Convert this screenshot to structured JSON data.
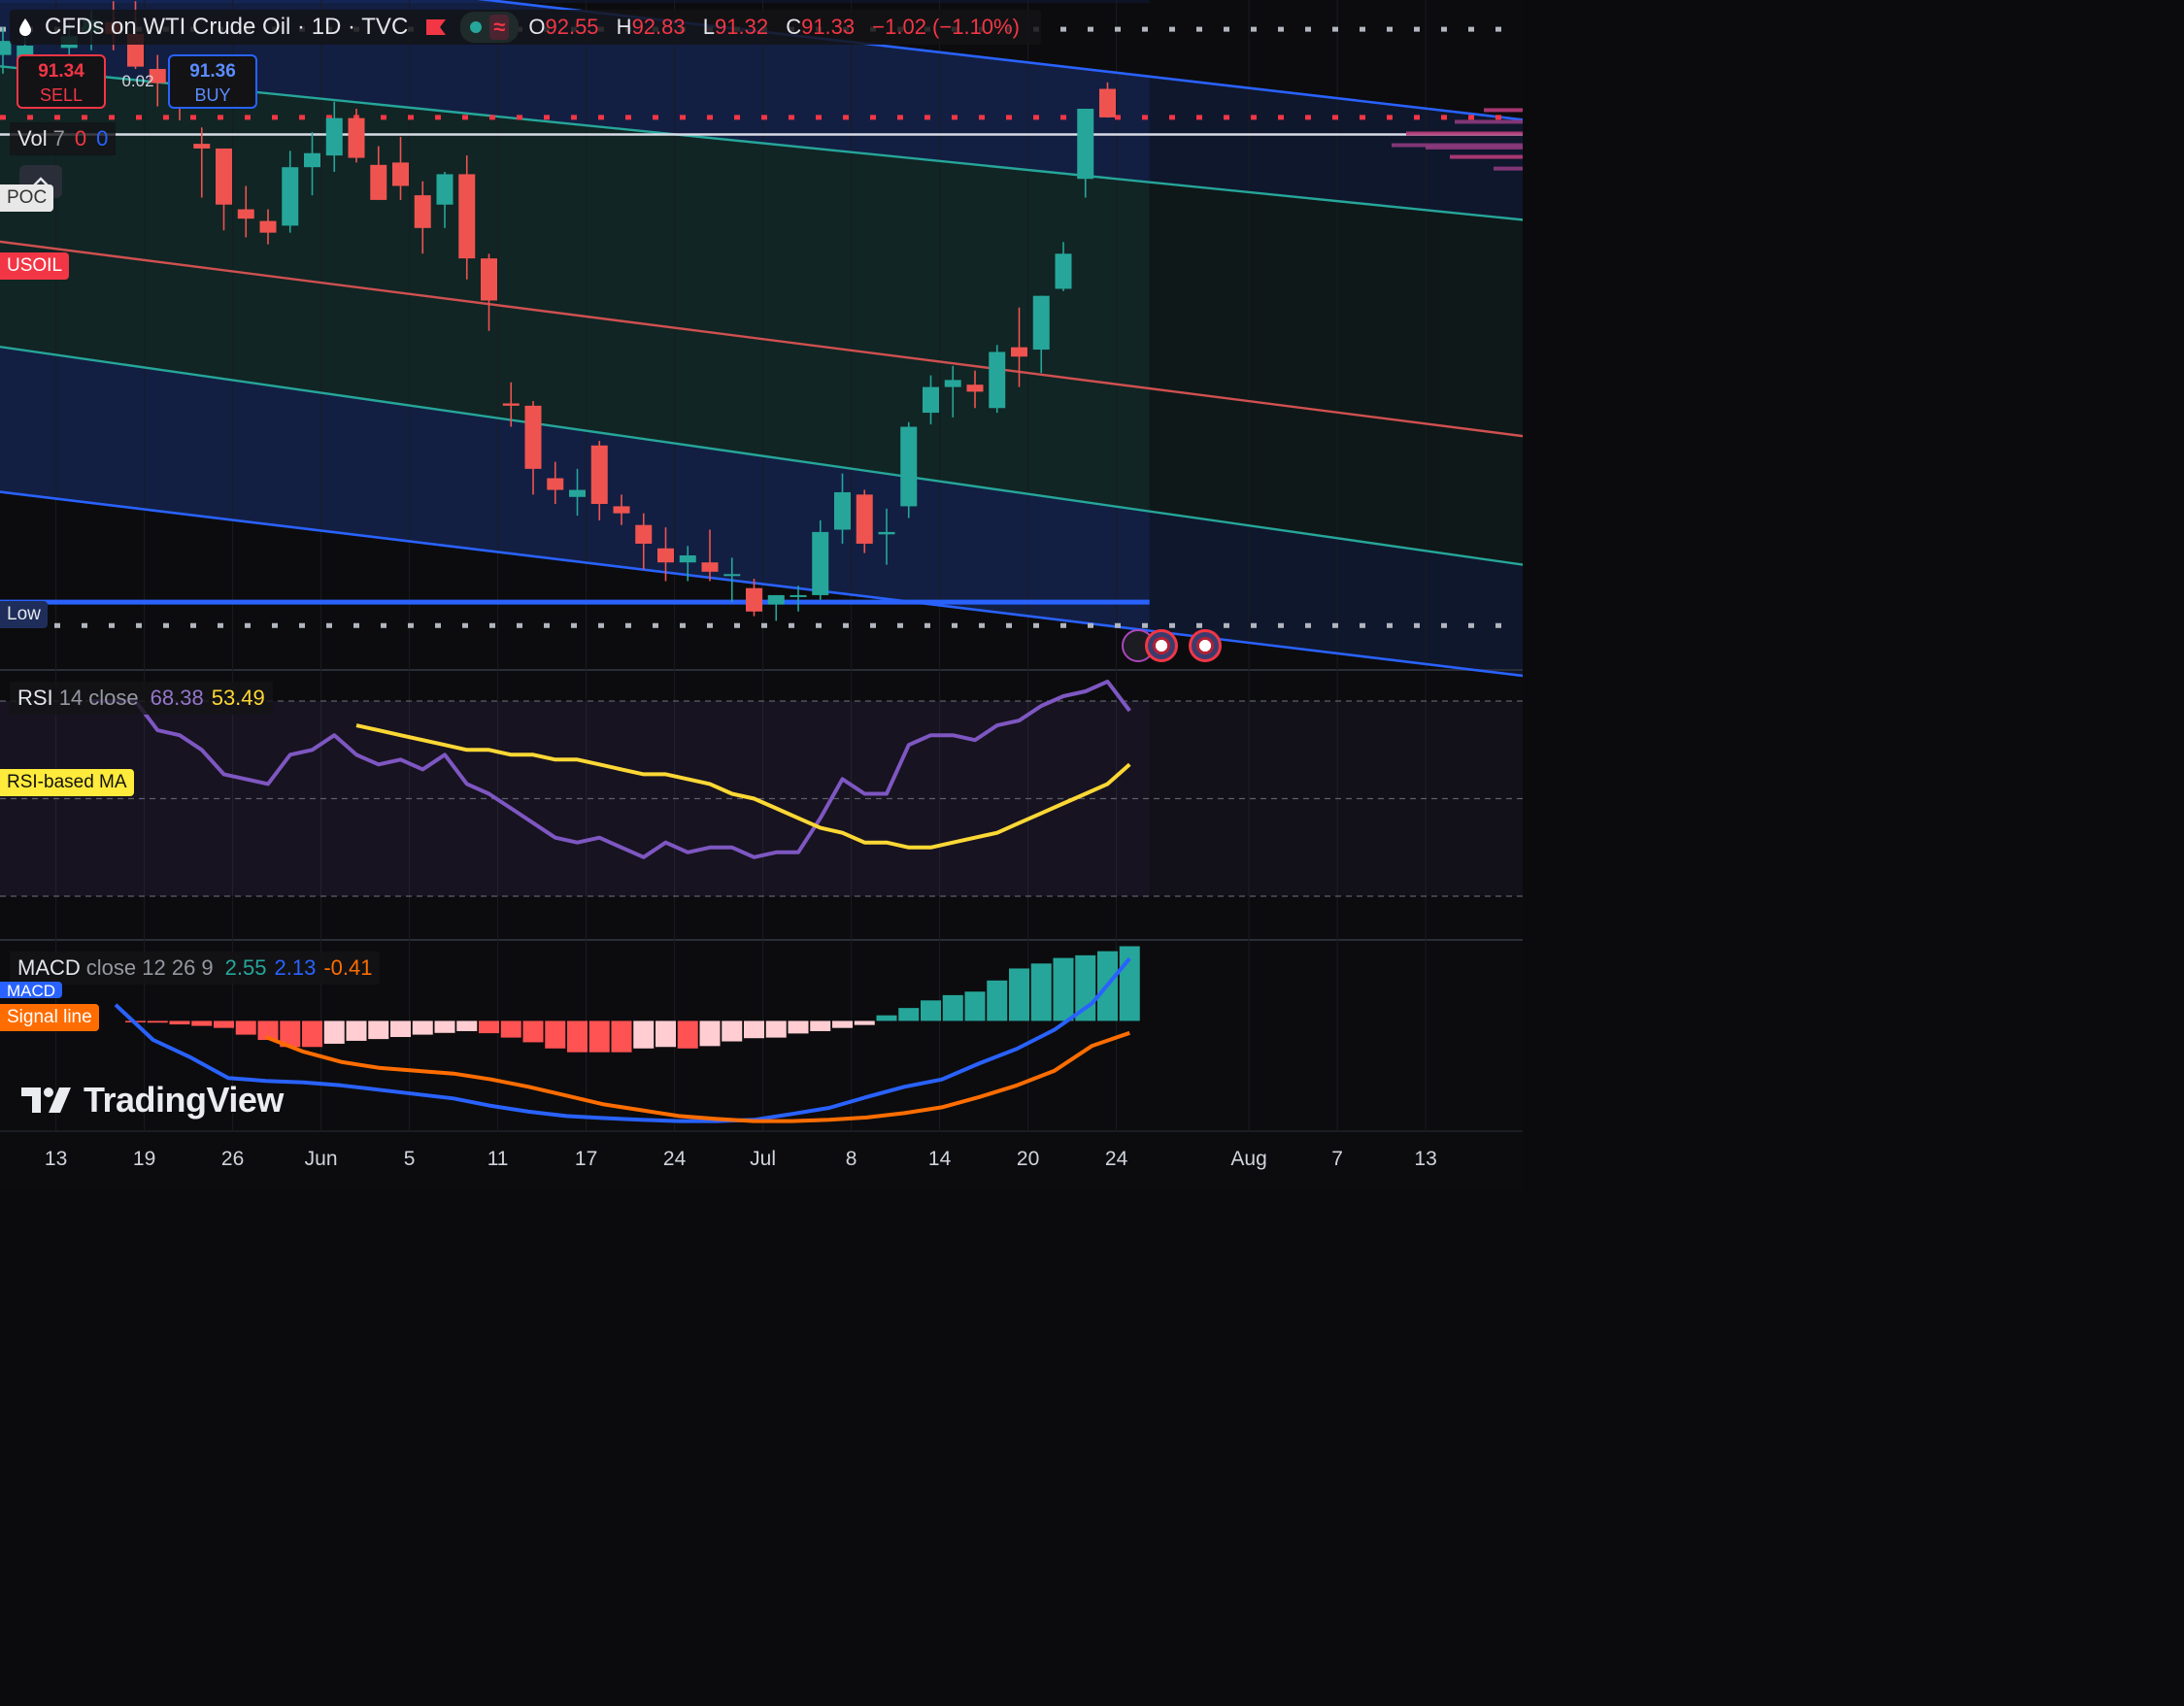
{
  "header": {
    "symbol_title": "CFDs on WTI Crude Oil · 1D · TVC",
    "ohlc": [
      {
        "k": "O",
        "v": "92.55"
      },
      {
        "k": "H",
        "v": "92.83"
      },
      {
        "k": "L",
        "v": "91.32"
      },
      {
        "k": "C",
        "v": "91.33"
      }
    ],
    "change": "−1.02 (−1.10%)"
  },
  "trade": {
    "sell_price": "91.34",
    "sell_label": "SELL",
    "spread": "0.02",
    "buy_price": "91.36",
    "buy_label": "BUY"
  },
  "volume": {
    "label": "Vol",
    "length": "7",
    "v1": "0",
    "v2": "0"
  },
  "price_tags": {
    "poc": "POC",
    "usoil": "USOIL",
    "low": "Low"
  },
  "rsi": {
    "label": "RSI",
    "params": "14 close",
    "value": "68.38",
    "ma_value": "53.49",
    "ma_tag": "RSI-based MA"
  },
  "macd": {
    "label": "MACD",
    "params": "close 12 26 9",
    "hist": "2.55",
    "macd": "2.13",
    "signal": "-0.41",
    "macd_tag": "MACD",
    "signal_tag": "Signal line"
  },
  "logo": {
    "text": "TradingView"
  },
  "colors": {
    "up": "#26a69a",
    "down": "#ef5350",
    "rsi": "#7e57c2",
    "rsi_ma": "#fdd835",
    "macd": "#2962ff",
    "signal": "#ff6d00",
    "channel": "#2962ff",
    "channel_mid": "#d05050",
    "channel_inner": "#26a69a"
  },
  "chart_data": [
    {
      "type": "candlestick",
      "title": "CFDs on WTI Crude Oil · 1D · TVC",
      "x_ticks": [
        "13",
        "19",
        "26",
        "Jun",
        "5",
        "11",
        "17",
        "24",
        "Jul",
        "8",
        "14",
        "20",
        "24",
        "Aug",
        "7",
        "13"
      ],
      "ylim": [
        67.7,
        96.35
      ],
      "candles": [
        {
          "o": 94.0,
          "h": 95.2,
          "l": 93.2,
          "c": 94.6
        },
        {
          "o": 93.8,
          "h": 94.8,
          "l": 93.0,
          "c": 94.4
        },
        {
          "o": 92.9,
          "h": 93.4,
          "l": 92.2,
          "c": 93.5
        },
        {
          "o": 94.3,
          "h": 95.4,
          "l": 93.5,
          "c": 94.8
        },
        {
          "o": 95.0,
          "h": 95.9,
          "l": 94.2,
          "c": 95.5
        },
        {
          "o": 95.4,
          "h": 96.3,
          "l": 94.2,
          "c": 94.9
        },
        {
          "o": 94.9,
          "h": 96.3,
          "l": 93.4,
          "c": 93.5
        },
        {
          "o": 93.4,
          "h": 94.0,
          "l": 91.8,
          "c": 92.8
        },
        {
          "o": 92.8,
          "h": 93.6,
          "l": 91.2,
          "c": 92.2
        },
        {
          "o": 90.2,
          "h": 90.9,
          "l": 87.9,
          "c": 90.0
        },
        {
          "o": 90.0,
          "h": 90.0,
          "l": 86.5,
          "c": 87.6
        },
        {
          "o": 87.4,
          "h": 88.4,
          "l": 86.2,
          "c": 87.0
        },
        {
          "o": 86.9,
          "h": 87.4,
          "l": 85.9,
          "c": 86.4
        },
        {
          "o": 86.7,
          "h": 89.9,
          "l": 86.4,
          "c": 89.2
        },
        {
          "o": 89.2,
          "h": 90.7,
          "l": 88.0,
          "c": 89.8
        },
        {
          "o": 89.7,
          "h": 92.0,
          "l": 89.0,
          "c": 91.3
        },
        {
          "o": 91.3,
          "h": 91.7,
          "l": 89.4,
          "c": 89.6
        },
        {
          "o": 89.3,
          "h": 90.1,
          "l": 87.8,
          "c": 87.8
        },
        {
          "o": 89.4,
          "h": 90.5,
          "l": 87.8,
          "c": 88.4
        },
        {
          "o": 88.0,
          "h": 88.6,
          "l": 85.5,
          "c": 86.6
        },
        {
          "o": 87.6,
          "h": 89.0,
          "l": 86.6,
          "c": 88.9
        },
        {
          "o": 88.9,
          "h": 89.7,
          "l": 84.4,
          "c": 85.3
        },
        {
          "o": 85.3,
          "h": 85.5,
          "l": 82.2,
          "c": 83.5
        },
        {
          "o": 79.1,
          "h": 80.0,
          "l": 78.1,
          "c": 79.0
        },
        {
          "o": 79.0,
          "h": 79.2,
          "l": 75.2,
          "c": 76.3
        },
        {
          "o": 75.9,
          "h": 76.6,
          "l": 74.8,
          "c": 75.4
        },
        {
          "o": 75.1,
          "h": 76.3,
          "l": 74.3,
          "c": 75.4
        },
        {
          "o": 77.3,
          "h": 77.5,
          "l": 74.1,
          "c": 74.8
        },
        {
          "o": 74.7,
          "h": 75.2,
          "l": 73.9,
          "c": 74.4
        },
        {
          "o": 73.9,
          "h": 74.4,
          "l": 72.0,
          "c": 73.1
        },
        {
          "o": 72.9,
          "h": 73.8,
          "l": 71.5,
          "c": 72.3
        },
        {
          "o": 72.3,
          "h": 73.0,
          "l": 71.5,
          "c": 72.6
        },
        {
          "o": 72.3,
          "h": 73.7,
          "l": 71.5,
          "c": 71.9
        },
        {
          "o": 71.8,
          "h": 72.5,
          "l": 70.6,
          "c": 71.8
        },
        {
          "o": 71.2,
          "h": 71.6,
          "l": 70.0,
          "c": 70.2
        },
        {
          "o": 70.5,
          "h": 70.9,
          "l": 69.8,
          "c": 70.9
        },
        {
          "o": 70.9,
          "h": 71.3,
          "l": 70.2,
          "c": 70.9
        },
        {
          "o": 70.9,
          "h": 74.1,
          "l": 70.7,
          "c": 73.6
        },
        {
          "o": 73.7,
          "h": 76.1,
          "l": 73.1,
          "c": 75.3
        },
        {
          "o": 75.2,
          "h": 75.4,
          "l": 72.7,
          "c": 73.1
        },
        {
          "o": 73.5,
          "h": 74.6,
          "l": 72.2,
          "c": 73.6
        },
        {
          "o": 74.7,
          "h": 78.3,
          "l": 74.2,
          "c": 78.1
        },
        {
          "o": 78.7,
          "h": 80.3,
          "l": 78.2,
          "c": 79.8
        },
        {
          "o": 79.8,
          "h": 80.7,
          "l": 78.5,
          "c": 80.1
        },
        {
          "o": 79.9,
          "h": 80.5,
          "l": 78.9,
          "c": 79.6
        },
        {
          "o": 78.9,
          "h": 81.6,
          "l": 78.7,
          "c": 81.3
        },
        {
          "o": 81.5,
          "h": 83.2,
          "l": 79.8,
          "c": 81.1
        },
        {
          "o": 81.4,
          "h": 83.7,
          "l": 80.4,
          "c": 83.7
        },
        {
          "o": 84.0,
          "h": 86.0,
          "l": 83.9,
          "c": 85.5
        },
        {
          "o": 88.7,
          "h": 91.5,
          "l": 87.9,
          "c": 91.7
        },
        {
          "o": 92.55,
          "h": 92.83,
          "l": 91.32,
          "c": 91.33
        }
      ],
      "levels": [
        {
          "name": "POC",
          "value": 90.6
        },
        {
          "name": "USOIL",
          "value": 91.33
        },
        {
          "name": "Low",
          "value": 69.6
        }
      ]
    },
    {
      "type": "line",
      "title": "RSI 14 close",
      "ylim": [
        0,
        100
      ],
      "guides": [
        70,
        50,
        30
      ],
      "series": [
        {
          "name": "RSI",
          "values": [
            70,
            70,
            70,
            64,
            63,
            60,
            55,
            54,
            53,
            59,
            60,
            63,
            59,
            57,
            58,
            56,
            59,
            53,
            51,
            48,
            45,
            42,
            41,
            42,
            40,
            38,
            41,
            39,
            40,
            40,
            38,
            39,
            39,
            46,
            54,
            51,
            51,
            61,
            63,
            63,
            62,
            65,
            66,
            69,
            71,
            72,
            74,
            68
          ]
        },
        {
          "name": "RSI-based MA",
          "values": [
            65,
            64,
            63,
            62,
            61,
            60,
            60,
            59,
            59,
            58,
            58,
            57,
            56,
            55,
            55,
            54,
            53,
            51,
            50,
            48,
            46,
            44,
            43,
            41,
            41,
            40,
            40,
            41,
            42,
            43,
            45,
            47,
            49,
            51,
            53,
            57
          ]
        }
      ]
    },
    {
      "type": "bar",
      "title": "MACD close 12 26 9",
      "ylim": [
        -3.7,
        2.7
      ],
      "series": [
        {
          "name": "Histogram",
          "values": [
            -0.05,
            -0.06,
            -0.12,
            -0.17,
            -0.24,
            -0.47,
            -0.65,
            -0.89,
            -0.89,
            -0.78,
            -0.68,
            -0.62,
            -0.55,
            -0.47,
            -0.41,
            -0.35,
            -0.42,
            -0.57,
            -0.73,
            -0.94,
            -1.07,
            -1.07,
            -1.07,
            -0.94,
            -0.89,
            -0.94,
            -0.86,
            -0.7,
            -0.59,
            -0.57,
            -0.43,
            -0.35,
            -0.24,
            -0.14,
            0.19,
            0.44,
            0.7,
            0.88,
            1.0,
            1.38,
            1.79,
            1.96,
            2.15,
            2.24,
            2.38,
            2.55
          ]
        },
        {
          "name": "MACD",
          "values": [
            0.55,
            -0.65,
            -1.25,
            -1.95,
            -2.05,
            -2.1,
            -2.2,
            -2.35,
            -2.5,
            -2.65,
            -2.9,
            -3.1,
            -3.25,
            -3.32,
            -3.38,
            -3.42,
            -3.42,
            -3.38,
            -3.18,
            -2.97,
            -2.6,
            -2.25,
            -2.0,
            -1.45,
            -0.95,
            -0.3,
            0.6,
            2.13
          ]
        },
        {
          "name": "Signal line",
          "values": [
            -0.55,
            -1.05,
            -1.4,
            -1.6,
            -1.7,
            -1.8,
            -2.0,
            -2.25,
            -2.55,
            -2.85,
            -3.05,
            -3.25,
            -3.35,
            -3.42,
            -3.42,
            -3.38,
            -3.3,
            -3.15,
            -2.95,
            -2.6,
            -2.2,
            -1.7,
            -0.85,
            -0.41
          ]
        }
      ]
    }
  ]
}
